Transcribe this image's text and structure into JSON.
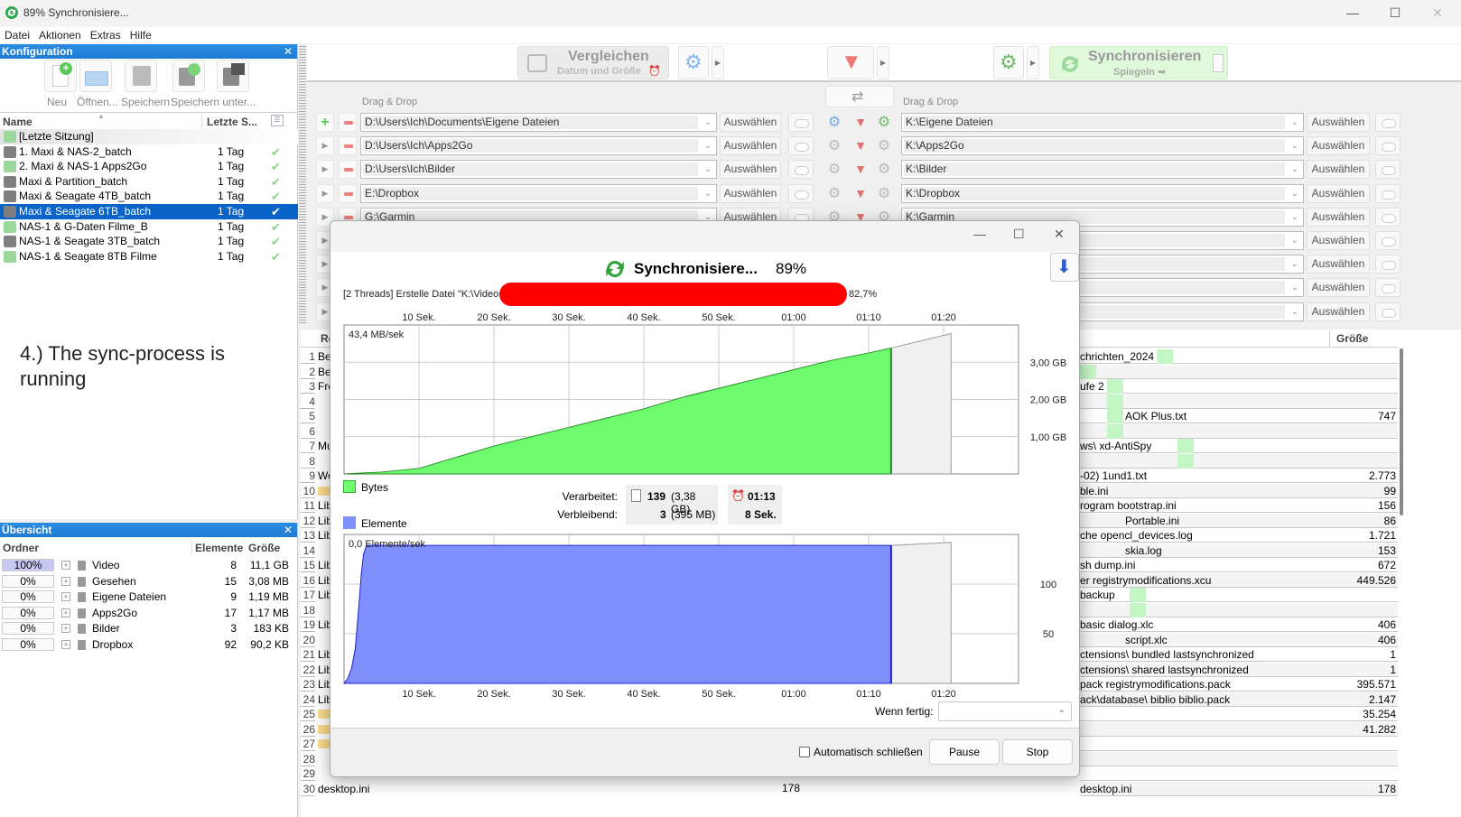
{
  "window": {
    "title": "89% Synchronisiere...",
    "controls": {
      "minimize": "—",
      "maximize": "☐",
      "close": "✕"
    }
  },
  "menu": [
    "Datei",
    "Aktionen",
    "Extras",
    "Hilfe"
  ],
  "config_panel": {
    "title": "Konfiguration",
    "toolbar": [
      "Neu",
      "Öffnen...",
      "Speichern",
      "Speichern unter..."
    ],
    "columns": {
      "name": "Name",
      "last": "Letzte S..."
    },
    "items": [
      {
        "name": "[Letzte Sitzung]",
        "last": "",
        "ok": false,
        "icon": "sync",
        "selected": false
      },
      {
        "name": "1. Maxi & NAS-2_batch",
        "last": "1 Tag",
        "ok": true,
        "icon": "batch",
        "selected": false
      },
      {
        "name": "2. Maxi & NAS-1 Apps2Go",
        "last": "1 Tag",
        "ok": true,
        "icon": "sync",
        "selected": false
      },
      {
        "name": "Maxi & Partition_batch",
        "last": "1 Tag",
        "ok": true,
        "icon": "batch",
        "selected": false
      },
      {
        "name": "Maxi & Seagate 4TB_batch",
        "last": "1 Tag",
        "ok": true,
        "icon": "batch",
        "selected": false
      },
      {
        "name": "Maxi & Seagate 6TB_batch",
        "last": "1 Tag",
        "ok": true,
        "icon": "batch",
        "selected": true
      },
      {
        "name": "NAS-1 & G-Daten Filme_B",
        "last": "1 Tag",
        "ok": true,
        "icon": "sync",
        "selected": false
      },
      {
        "name": "NAS-1 & Seagate 3TB_batch",
        "last": "1 Tag",
        "ok": true,
        "icon": "batch",
        "selected": false
      },
      {
        "name": "NAS-1 & Seagate 8TB Filme",
        "last": "1 Tag",
        "ok": true,
        "icon": "sync",
        "selected": false
      }
    ]
  },
  "annotation": "4.) The sync-process is running",
  "overview_panel": {
    "title": "Übersicht",
    "columns": {
      "folder": "Ordner",
      "items": "Elemente",
      "size": "Größe"
    },
    "rows": [
      {
        "pct": "100%",
        "full": true,
        "name": "Video",
        "items": "8",
        "size": "11,1 GB"
      },
      {
        "pct": "0%",
        "full": false,
        "name": "Gesehen",
        "items": "15",
        "size": "3,08 MB"
      },
      {
        "pct": "0%",
        "full": false,
        "name": "Eigene Dateien",
        "items": "9",
        "size": "1,19 MB"
      },
      {
        "pct": "0%",
        "full": false,
        "name": "Apps2Go",
        "items": "17",
        "size": "1,17 MB"
      },
      {
        "pct": "0%",
        "full": false,
        "name": "Bilder",
        "items": "3",
        "size": "183 KB"
      },
      {
        "pct": "0%",
        "full": false,
        "name": "Dropbox",
        "items": "92",
        "size": "90,2 KB"
      }
    ]
  },
  "main_toolbar": {
    "compare": {
      "label": "Vergleichen",
      "sub": "Datum und Größe"
    },
    "sync": {
      "label": "Synchronisieren",
      "sub": "Spiegeln ➡"
    }
  },
  "folder_pairs": {
    "drag_drop": "Drag & Drop",
    "select_label": "Auswählen",
    "left": [
      "D:\\Users\\Ich\\Documents\\Eigene Dateien",
      "D:\\Users\\Ich\\Apps2Go",
      "D:\\Users\\Ich\\Bilder",
      "E:\\Dropbox",
      "G:\\Garmin",
      "",
      "",
      "",
      ""
    ],
    "right": [
      "K:\\Eigene Dateien",
      "K:\\Apps2Go",
      "K:\\Bilder",
      "K:\\Dropbox",
      "K:\\Garmin",
      "",
      "",
      "",
      ""
    ]
  },
  "file_grid": {
    "left_header": "Re",
    "right_header_size": "Größe",
    "left_rows": [
      {
        "n": "1",
        "t": "Be"
      },
      {
        "n": "2",
        "t": "Be"
      },
      {
        "n": "3",
        "t": "Fre"
      },
      {
        "n": "4",
        "t": ""
      },
      {
        "n": "5",
        "t": ""
      },
      {
        "n": "6",
        "t": ""
      },
      {
        "n": "7",
        "t": "Mu"
      },
      {
        "n": "8",
        "t": ""
      },
      {
        "n": "9",
        "t": "Wo"
      },
      {
        "n": "10",
        "t": ""
      },
      {
        "n": "11",
        "t": "Lib"
      },
      {
        "n": "12",
        "t": "Lib"
      },
      {
        "n": "13",
        "t": "Lib"
      },
      {
        "n": "14",
        "t": ""
      },
      {
        "n": "15",
        "t": "Lib"
      },
      {
        "n": "16",
        "t": "Lib"
      },
      {
        "n": "17",
        "t": "Lib"
      },
      {
        "n": "18",
        "t": ""
      },
      {
        "n": "19",
        "t": "Lib"
      },
      {
        "n": "20",
        "t": ""
      },
      {
        "n": "21",
        "t": "Lib"
      },
      {
        "n": "22",
        "t": "Lib"
      },
      {
        "n": "23",
        "t": "Lib"
      },
      {
        "n": "24",
        "t": "Lib"
      },
      {
        "n": "25",
        "t": ""
      },
      {
        "n": "26",
        "t": ""
      },
      {
        "n": "27",
        "t": ""
      },
      {
        "n": "28",
        "t": ""
      },
      {
        "n": "29",
        "t": ""
      },
      {
        "n": "30",
        "t": "desktop.ini",
        "size": "178"
      }
    ],
    "right_rows": [
      {
        "t": "chrichten_2024",
        "s": ""
      },
      {
        "t": "",
        "s": ""
      },
      {
        "t": "ufe 2",
        "s": ""
      },
      {
        "t": "",
        "s": ""
      },
      {
        "t": "AOK Plus.txt",
        "s": "747"
      },
      {
        "t": "",
        "s": ""
      },
      {
        "t": "ws\\  xd-AntiSpy",
        "s": ""
      },
      {
        "t": "",
        "s": ""
      },
      {
        "t": "-02)  1und1.txt",
        "s": "2.773"
      },
      {
        "t": "ble.ini",
        "s": "99"
      },
      {
        "t": "rogram  bootstrap.ini",
        "s": "156"
      },
      {
        "t": "Portable.ini",
        "s": "86"
      },
      {
        "t": "che  opencl_devices.log",
        "s": "1.721"
      },
      {
        "t": "skia.log",
        "s": "153"
      },
      {
        "t": "sh  dump.ini",
        "s": "672"
      },
      {
        "t": "er  registrymodifications.xcu",
        "s": "449.526"
      },
      {
        "t": "backup",
        "s": ""
      },
      {
        "t": "",
        "s": ""
      },
      {
        "t": "basic  dialog.xlc",
        "s": "406"
      },
      {
        "t": "script.xlc",
        "s": "406"
      },
      {
        "t": "ctensions\\  bundled  lastsynchronized",
        "s": "1"
      },
      {
        "t": "ctensions\\  shared  lastsynchronized",
        "s": "1"
      },
      {
        "t": "pack  registrymodifications.pack",
        "s": "395.571"
      },
      {
        "t": "ack\\database\\  biblio  biblio.pack",
        "s": "2.147"
      },
      {
        "t": "",
        "s": "35.254"
      },
      {
        "t": "",
        "s": "41.282"
      },
      {
        "t": "",
        "s": ""
      },
      {
        "t": "",
        "s": ""
      },
      {
        "t": "",
        "s": ""
      },
      {
        "t": "desktop.ini",
        "s": "178"
      }
    ]
  },
  "dialog": {
    "title_main": "Synchronisiere...",
    "title_pct": "89%",
    "status_prefix": "[2 Threads] Erstelle Datei \"K:\\Video",
    "status_pct": "82,7%",
    "legend_bytes": "Bytes",
    "legend_items": "Elemente",
    "processed_label": "Verarbeitet:",
    "remaining_label": "Verbleibend:",
    "processed_count": "139",
    "processed_size": "(3,38 GB)",
    "remaining_count": "3",
    "remaining_size": "(395 MB)",
    "elapsed": "01:13",
    "remaining_time": "8 Sek.",
    "when_done_label": "Wenn fertig:",
    "when_done_value": "",
    "auto_close_label": "Automatisch schließen",
    "auto_close_checked": false,
    "pause_label": "Pause",
    "stop_label": "Stop",
    "controls": {
      "minimize": "—",
      "maximize": "☐",
      "close": "✕"
    }
  },
  "chart_data": [
    {
      "type": "area",
      "title": "Bytes",
      "rate_label": "43,4 MB/sek",
      "x_ticks": [
        "10 Sek.",
        "20 Sek.",
        "30 Sek.",
        "40 Sek.",
        "50 Sek.",
        "01:00",
        "01:10",
        "01:20"
      ],
      "x_tick_values": [
        10,
        20,
        30,
        40,
        50,
        60,
        70,
        80
      ],
      "y_ticks": [
        "1,00 GB",
        "2,00 GB",
        "3,00 GB"
      ],
      "y_tick_values": [
        1,
        2,
        3
      ],
      "xlim": [
        0,
        90
      ],
      "ylim": [
        0,
        4
      ],
      "current_time": 73,
      "projected_end": 81,
      "projected_total": 3.77,
      "color": "#6efc6e",
      "x": [
        0,
        2,
        5,
        10,
        15,
        20,
        25,
        30,
        35,
        40,
        45,
        50,
        55,
        60,
        65,
        70,
        73
      ],
      "y": [
        0,
        0.02,
        0.05,
        0.15,
        0.45,
        0.75,
        1.0,
        1.25,
        1.5,
        1.75,
        2.05,
        2.3,
        2.55,
        2.8,
        3.05,
        3.25,
        3.38
      ]
    },
    {
      "type": "area",
      "title": "Elemente",
      "rate_label": "0,0 Elemente/sek",
      "x_ticks": [
        "10 Sek.",
        "20 Sek.",
        "30 Sek.",
        "40 Sek.",
        "50 Sek.",
        "01:00",
        "01:10",
        "01:20"
      ],
      "x_tick_values": [
        10,
        20,
        30,
        40,
        50,
        60,
        70,
        80
      ],
      "y_ticks": [
        "50",
        "100"
      ],
      "y_tick_values": [
        50,
        100
      ],
      "xlim": [
        0,
        90
      ],
      "ylim": [
        0,
        150
      ],
      "current_time": 73,
      "projected_end": 81,
      "projected_total": 142,
      "color": "#7f8ffc",
      "x": [
        0,
        0.5,
        1,
        1.5,
        2,
        2.3,
        2.6,
        3,
        73
      ],
      "y": [
        0,
        5,
        15,
        35,
        80,
        110,
        130,
        139,
        139
      ]
    }
  ]
}
